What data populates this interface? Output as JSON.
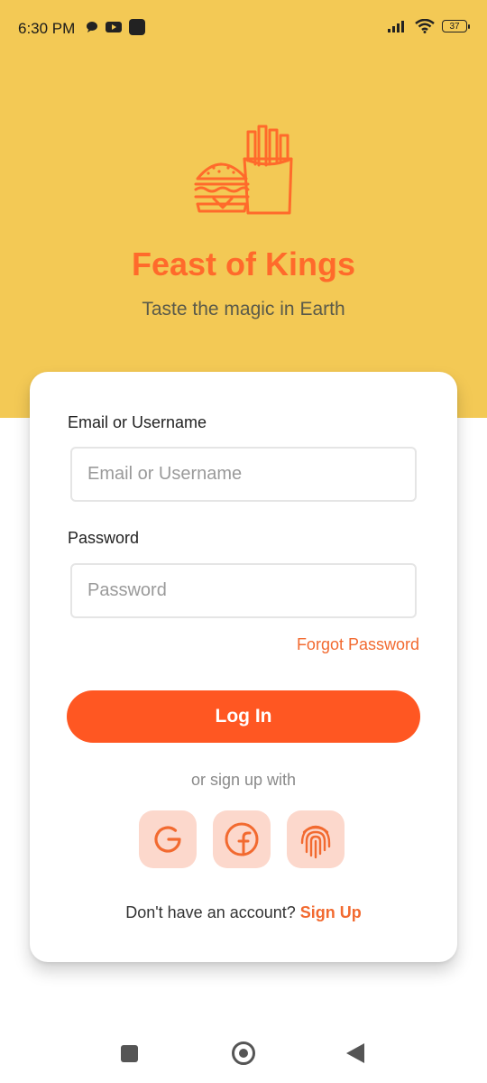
{
  "status_bar": {
    "time": "6:30 PM",
    "battery_level": "37",
    "left_icons": [
      "chat-bubble-icon",
      "youtube-icon",
      "app-square-icon"
    ],
    "right_icons": [
      "signal-icon",
      "wifi-icon",
      "battery-icon"
    ]
  },
  "brand": {
    "title": "Feast of Kings",
    "subtitle": "Taste the magic in Earth",
    "logo_icon": "burger-fries-icon"
  },
  "form": {
    "email_label": "Email or Username",
    "email_placeholder": "Email or Username",
    "email_value": "",
    "password_label": "Password",
    "password_placeholder": "Password",
    "password_value": "",
    "forgot_password": "Forgot Password",
    "login_button": "Log In"
  },
  "social": {
    "divider_text": "or sign up with",
    "providers": [
      "google-icon",
      "facebook-icon",
      "fingerprint-icon"
    ]
  },
  "signup": {
    "prompt": "Don't have an account?",
    "link": "Sign Up"
  },
  "nav_bar": {
    "buttons": [
      "recents-square-icon",
      "home-circle-icon",
      "back-triangle-icon"
    ]
  },
  "colors": {
    "hero_background": "#F3C955",
    "accent": "#FF5722",
    "brand_text": "#FF6A2B",
    "social_background": "#FCD8CC"
  }
}
